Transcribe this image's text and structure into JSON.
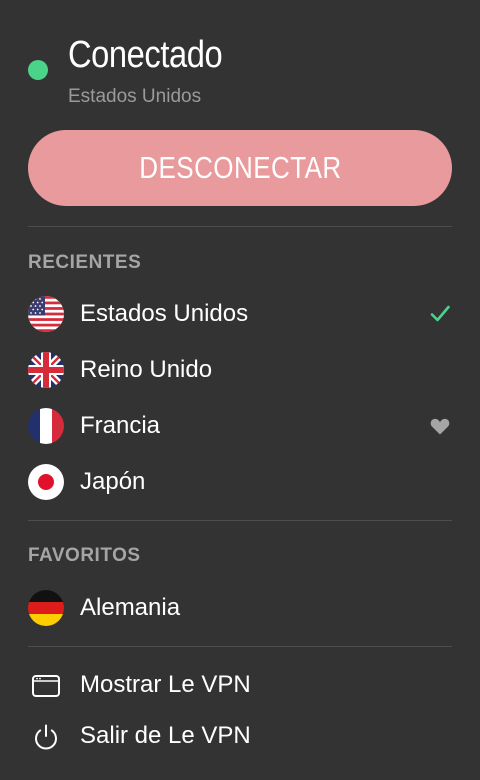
{
  "status": {
    "title": "Conectado",
    "subtitle": "Estados Unidos",
    "dot_color": "#4cd38a"
  },
  "disconnect_button": {
    "label": "DESCONECTAR",
    "color": "#e89a9c"
  },
  "recent": {
    "header": "RECIENTES",
    "items": [
      {
        "label": "Estados Unidos",
        "flag": "us-flag-icon",
        "trailing": "checkmark-icon"
      },
      {
        "label": "Reino Unido",
        "flag": "uk-flag-icon",
        "trailing": ""
      },
      {
        "label": "Francia",
        "flag": "france-flag-icon",
        "trailing": "heart-icon"
      },
      {
        "label": "Japón",
        "flag": "japan-flag-icon",
        "trailing": ""
      }
    ]
  },
  "favorites": {
    "header": "FAVORITOS",
    "items": [
      {
        "label": "Alemania",
        "flag": "germany-flag-icon"
      }
    ]
  },
  "actions": [
    {
      "label": "Mostrar Le VPN",
      "icon": "window-icon"
    },
    {
      "label": "Salir de Le VPN",
      "icon": "power-icon"
    }
  ],
  "colors": {
    "background": "#333333",
    "connected": "#4cd38a",
    "check": "#4cd38a",
    "secondary_text": "#9a9a9a"
  }
}
